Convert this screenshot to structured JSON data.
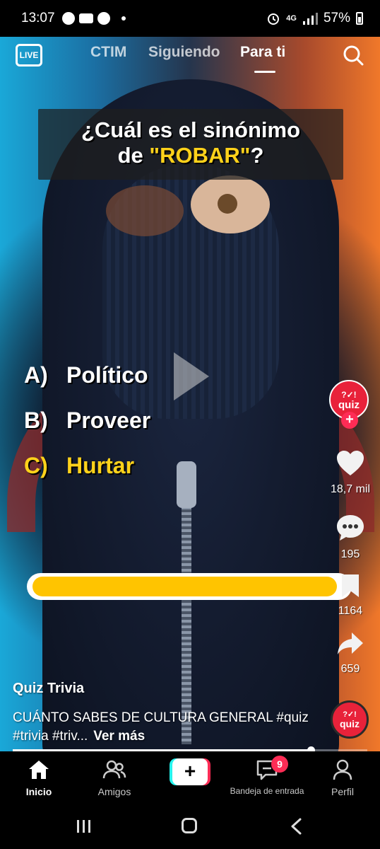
{
  "status_bar": {
    "time": "13:07",
    "network": "4G",
    "battery": "57%"
  },
  "top_nav": {
    "live_label": "LIVE",
    "tabs": [
      "CTIM",
      "Siguiendo",
      "Para ti"
    ],
    "active_tab": "Para ti"
  },
  "video": {
    "question_line1": "¿Cuál es el sinónimo",
    "question_line2_prefix": "de ",
    "question_highlight": "\"ROBAR\"",
    "question_suffix": "?",
    "answers": [
      {
        "letter": "A)",
        "text": "Político"
      },
      {
        "letter": "B)",
        "text": "Proveer"
      },
      {
        "letter": "C)",
        "text": "Hurtar"
      }
    ],
    "highlight_color": "#ffd21a",
    "progress_fill_fraction": 0.97
  },
  "side_bar": {
    "avatar_label_top": "?✓!",
    "avatar_label_bottom": "quiz",
    "likes": "18,7 mil",
    "comments": "195",
    "saves": "1164",
    "shares": "659"
  },
  "caption": {
    "author": "Quiz Trivia",
    "text": "CUÁNTO SABES DE CULTURA GENERAL #quiz #trivia #triv...",
    "more_label": "Ver más",
    "seek_fraction": 0.84
  },
  "bottom_nav": {
    "items": [
      "Inicio",
      "Amigos",
      "Bandeja de entrada",
      "Perfil"
    ],
    "active": "Inicio",
    "inbox_badge": "9"
  },
  "colors": {
    "accent_red": "#fe2c55",
    "accent_cyan": "#25f4ee",
    "quiz_yellow": "#ffc400"
  }
}
